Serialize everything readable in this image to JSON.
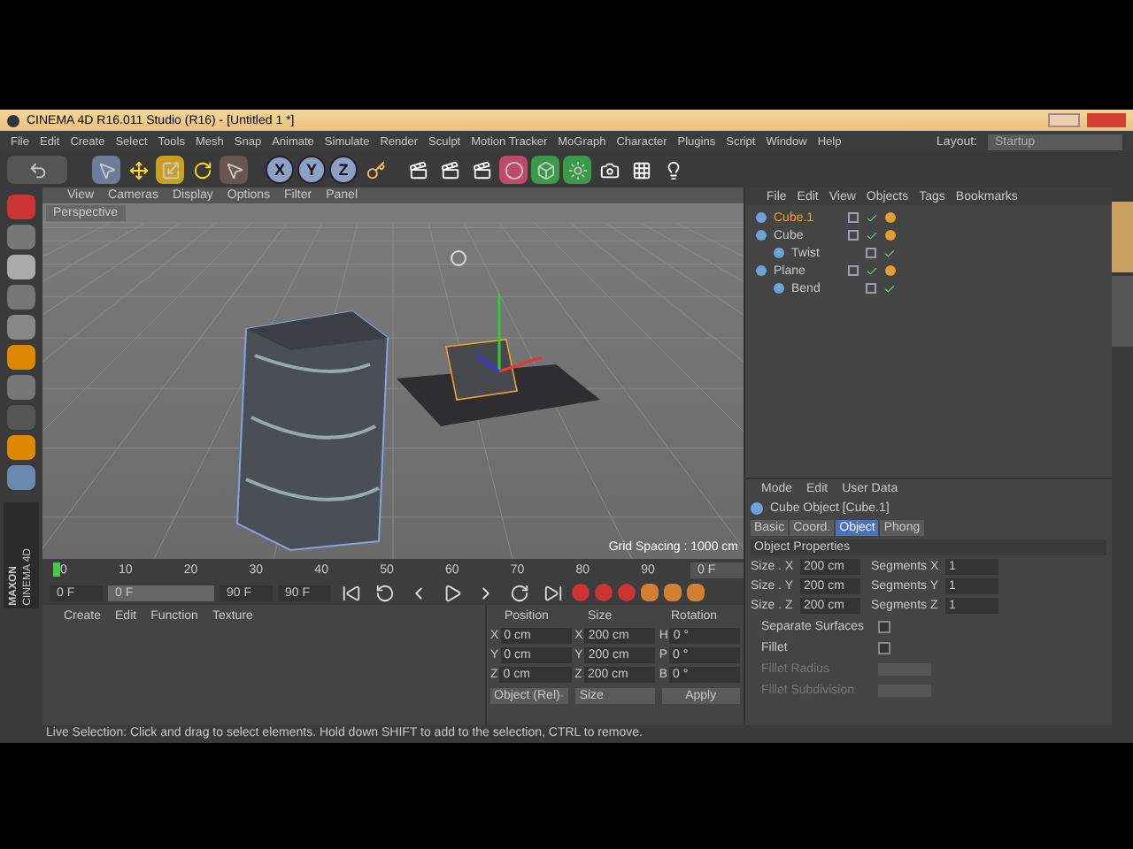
{
  "window": {
    "title": "CINEMA 4D R16.011 Studio (R16) - [Untitled 1 *]"
  },
  "menu": [
    "File",
    "Edit",
    "Create",
    "Select",
    "Tools",
    "Mesh",
    "Snap",
    "Animate",
    "Simulate",
    "Render",
    "Sculpt",
    "Motion Tracker",
    "MoGraph",
    "Character",
    "Plugins",
    "Script",
    "Window",
    "Help"
  ],
  "layout": {
    "label": "Layout:",
    "value": "Startup"
  },
  "toolbar_axes": [
    "X",
    "Y",
    "Z"
  ],
  "logo": {
    "line1": "MAXON",
    "line2": "CINEMA 4D"
  },
  "viewport": {
    "menu": [
      "View",
      "Cameras",
      "Display",
      "Options",
      "Filter",
      "Panel"
    ],
    "camera": "Perspective",
    "grid_spacing": "Grid Spacing : 1000 cm"
  },
  "timeline": {
    "ticks": [
      "0",
      "10",
      "20",
      "30",
      "40",
      "50",
      "60",
      "70",
      "80",
      "90"
    ],
    "current": "0 F"
  },
  "transport": {
    "start": "0 F",
    "range": {
      "start": "0 F",
      "level": 1
    },
    "range_end": "90 F",
    "end": "90 F"
  },
  "materials": {
    "menu": [
      "Create",
      "Edit",
      "Function",
      "Texture"
    ]
  },
  "coordinates": {
    "headers": [
      "Position",
      "Size",
      "Rotation"
    ],
    "rows": [
      {
        "axis": "X",
        "position": "0 cm",
        "size_axis": "X",
        "size": "200 cm",
        "rot_axis": "H",
        "rotation": "0 °"
      },
      {
        "axis": "Y",
        "position": "0 cm",
        "size_axis": "Y",
        "size": "200 cm",
        "rot_axis": "P",
        "rotation": "0 °"
      },
      {
        "axis": "Z",
        "position": "0 cm",
        "size_axis": "Z",
        "size": "200 cm",
        "rot_axis": "B",
        "rotation": "0 °"
      }
    ],
    "mode": "Object (Rel)",
    "size_mode": "Size",
    "apply": "Apply"
  },
  "objects": {
    "menu": [
      "File",
      "Edit",
      "View",
      "Objects",
      "Tags",
      "Bookmarks"
    ],
    "tree": [
      {
        "name": "Cube.1",
        "selected": true
      },
      {
        "name": "Cube",
        "selected": false,
        "children": [
          {
            "name": "Twist",
            "selected": false
          }
        ]
      },
      {
        "name": "Plane",
        "selected": false,
        "children": [
          {
            "name": "Bend",
            "selected": false
          }
        ]
      }
    ]
  },
  "attributes": {
    "menu": [
      "Mode",
      "Edit",
      "User Data"
    ],
    "title": "Cube Object [Cube.1]",
    "tabs": [
      {
        "label": "Basic",
        "selected": false
      },
      {
        "label": "Coord.",
        "selected": false
      },
      {
        "label": "Object",
        "selected": true
      },
      {
        "label": "Phong",
        "selected": false
      }
    ],
    "section": "Object Properties",
    "sizes": [
      {
        "label": "Size . X",
        "value": "200 cm",
        "seg_label": "Segments X",
        "seg_value": "1"
      },
      {
        "label": "Size . Y",
        "value": "200 cm",
        "seg_label": "Segments Y",
        "seg_value": "1"
      },
      {
        "label": "Size . Z",
        "value": "200 cm",
        "seg_label": "Segments Z",
        "seg_value": "1"
      }
    ],
    "options": [
      {
        "kind": "check",
        "label": "Separate Surfaces",
        "checked": false,
        "disabled": false
      },
      {
        "kind": "check",
        "label": "Fillet",
        "checked": false,
        "disabled": false
      },
      {
        "kind": "field",
        "label": "Fillet Radius",
        "disabled": true
      },
      {
        "kind": "field",
        "label": "Fillet Subdivision",
        "disabled": true
      }
    ]
  },
  "status_bar": "Live Selection: Click and drag to select elements. Hold down SHIFT to add to the selection, CTRL to remove."
}
